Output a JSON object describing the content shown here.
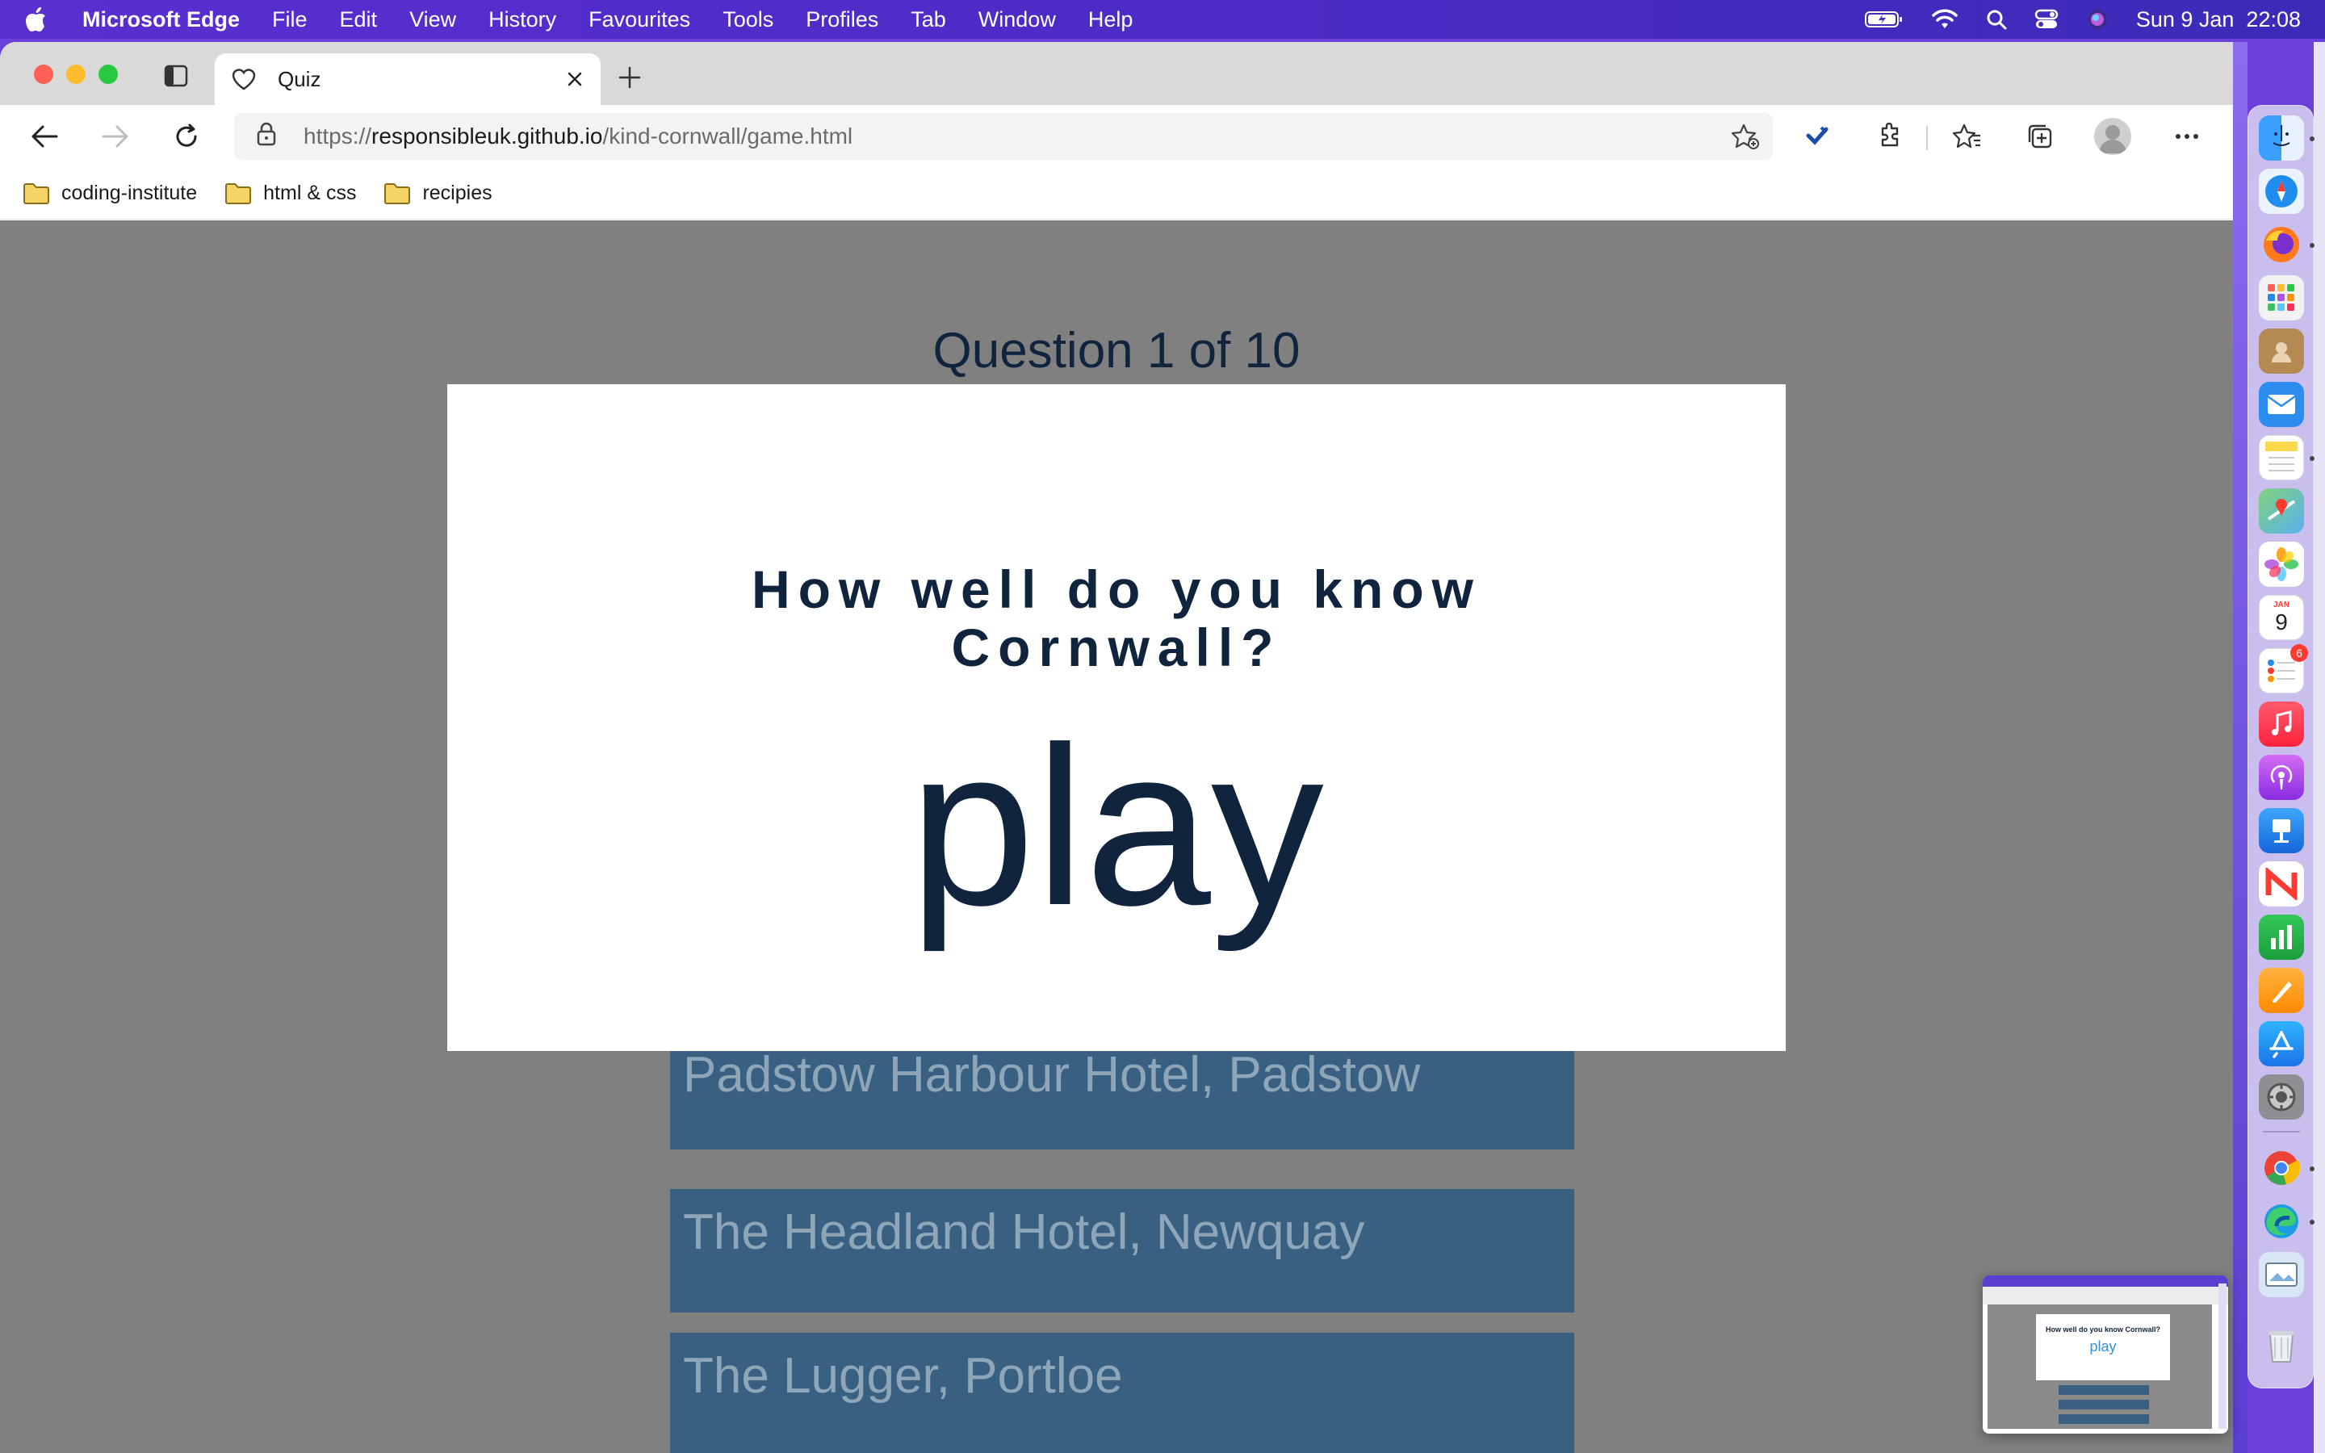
{
  "menubar": {
    "app_name": "Microsoft Edge",
    "items": [
      "File",
      "Edit",
      "View",
      "History",
      "Favourites",
      "Tools",
      "Profiles",
      "Tab",
      "Window",
      "Help"
    ],
    "datetime": "Sun 9 Jan  22:08"
  },
  "browser": {
    "tab_title": "Quiz",
    "url_scheme": "https://",
    "url_host": "responsibleuk.github.io",
    "url_path": "/kind-cornwall/game.html",
    "bookmarks": [
      "coding-institute",
      "html & css",
      "recipies"
    ]
  },
  "page": {
    "question_counter": "Question 1 of 10",
    "modal_headline_line1": "How well do you know",
    "modal_headline_line2": "Cornwall?",
    "play_label": "play",
    "answers": [
      "Padstow Harbour Hotel, Padstow",
      "The Headland Hotel, Newquay",
      "The Lugger, Portloe"
    ]
  },
  "dock": {
    "calendar_month": "JAN",
    "calendar_day": "9",
    "reminders_badge": "6",
    "apps": [
      "finder-icon",
      "safari-icon",
      "firefox-icon",
      "launchpad-icon",
      "contacts-icon",
      "mail-icon",
      "notes-icon",
      "maps-icon",
      "photos-icon",
      "calendar-icon",
      "reminders-icon",
      "music-icon",
      "podcasts-icon",
      "keynote-icon",
      "news-icon",
      "numbers-icon",
      "pages-icon",
      "app-store-icon",
      "system-preferences-icon",
      "chrome-icon",
      "edge-icon",
      "preview-icon",
      "trash-icon"
    ]
  },
  "thumbnail": {
    "headline": "How well do you know Cornwall?",
    "play": "play"
  },
  "colors": {
    "page_bg": "#808080",
    "answer_bg": "#3a6081",
    "text_dark": "#10243d",
    "menubar": "#5a2fd0"
  }
}
